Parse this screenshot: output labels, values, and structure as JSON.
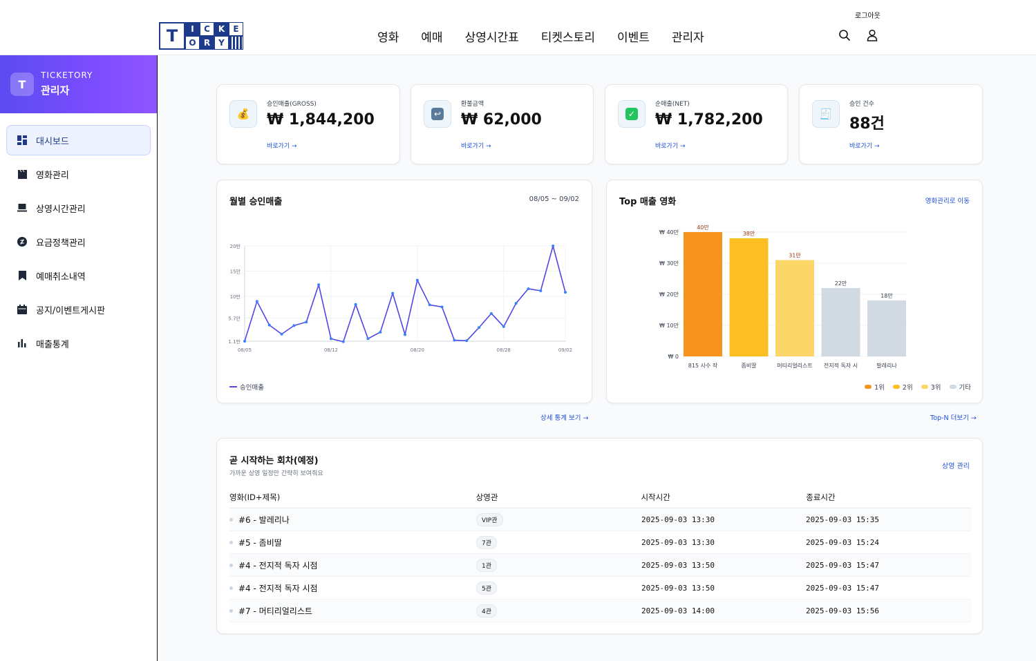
{
  "header": {
    "logout_label": "로그아웃",
    "logo": {
      "t": "T",
      "letters": [
        "I",
        "C",
        "K",
        "E",
        "O",
        "R",
        "Y",
        ""
      ]
    },
    "nav": [
      "영화",
      "예매",
      "상영시간표",
      "티켓스토리",
      "이벤트",
      "관리자"
    ],
    "icons": [
      "search-icon",
      "user-icon"
    ]
  },
  "sidebar": {
    "badge": "T",
    "brand": "TICKETORY",
    "title": "관리자",
    "items": [
      {
        "label": "대시보드",
        "icon": "dashboard-icon",
        "active": true
      },
      {
        "label": "영화관리",
        "icon": "clapper-icon"
      },
      {
        "label": "상영시간관리",
        "icon": "laptop-icon"
      },
      {
        "label": "요금정책관리",
        "icon": "currency-icon"
      },
      {
        "label": "예매취소내역",
        "icon": "bookmark-icon"
      },
      {
        "label": "공지/이벤트게시판",
        "icon": "calendar-icon"
      },
      {
        "label": "매출통계",
        "icon": "bar-chart-icon"
      }
    ]
  },
  "kpis": [
    {
      "label": "승인매출(GROSS)",
      "value": "₩ 1,844,200",
      "link": "바로가기 →",
      "icon": "money-bag-icon",
      "glyph": "💰"
    },
    {
      "label": "환불금액",
      "value": "₩ 62,000",
      "link": "바로가기 →",
      "icon": "return-icon",
      "glyph": "↩"
    },
    {
      "label": "순매출(NET)",
      "value": "₩ 1,782,200",
      "link": "바로가기 →",
      "icon": "check-icon",
      "glyph": "✓"
    },
    {
      "label": "승인 건수",
      "value": "88건",
      "link": "바로가기 →",
      "icon": "receipt-icon",
      "glyph": "🧾"
    }
  ],
  "line_card": {
    "title": "월별 승인매출",
    "range": "08/05 ~ 09/02",
    "legend": "승인매출",
    "under_link": "상세 통계 보기 →"
  },
  "bar_card": {
    "title": "Top 매출 영화",
    "link": "영화관리로 이동",
    "under_link": "Top-N 더보기 →",
    "legend": [
      {
        "label": "1위",
        "color": "#f7941d"
      },
      {
        "label": "2위",
        "color": "#fbbf24"
      },
      {
        "label": "3위",
        "color": "#fcd668"
      },
      {
        "label": "기타",
        "color": "#d1d9e3"
      }
    ]
  },
  "chart_data": [
    {
      "type": "line",
      "title": "월별 승인매출",
      "x_ticks": [
        "08/05",
        "08/12",
        "08/20",
        "08/28",
        "09/02"
      ],
      "y_ticks": [
        "1.1만",
        "5.7만",
        "10만",
        "15만",
        "20만"
      ],
      "ylim": [
        1.1,
        20
      ],
      "series": [
        {
          "name": "승인매출",
          "color": "#4f46e5",
          "values": [
            1.1,
            9.0,
            4.3,
            2.5,
            4.2,
            4.9,
            12.3,
            1.6,
            1.0,
            8.4,
            1.6,
            2.9,
            10.6,
            2.4,
            13.2,
            8.3,
            7.9,
            1.3,
            1.2,
            3.8,
            6.6,
            4.0,
            8.6,
            11.5,
            11.1,
            20.0,
            10.8
          ]
        }
      ]
    },
    {
      "type": "bar",
      "title": "Top 매출 영화",
      "categories": [
        "815 사수 작",
        "좀비딸",
        "머티리얼리스트",
        "전지적 독자 시",
        "발레리나"
      ],
      "values": [
        40,
        38,
        31,
        22,
        18
      ],
      "value_labels": [
        "40만",
        "38만",
        "31만",
        "22만",
        "18만"
      ],
      "colors": [
        "#f7941d",
        "#fbbf24",
        "#fcd668",
        "#d1d9e3",
        "#d1d9e3"
      ],
      "label_colors": [
        "#9a3412",
        "#9a3412",
        "#9a3412",
        "#374151",
        "#374151"
      ],
      "y_ticks": [
        "₩ 0",
        "₩ 10만",
        "₩ 20만",
        "₩ 30만",
        "₩ 40만"
      ],
      "ylim": [
        0,
        40
      ]
    }
  ],
  "upcoming": {
    "title": "곧 시작하는 회차(예정)",
    "subtitle": "가까운 상영 일정만 간략히 보여줘요",
    "link": "상영 관리",
    "columns": [
      "영화(ID+제목)",
      "상영관",
      "시작시간",
      "종료시간"
    ],
    "rows": [
      {
        "movie": "#6 - 발레리나",
        "hall": "VIP관",
        "start": "2025-09-03 13:30",
        "end": "2025-09-03 15:35"
      },
      {
        "movie": "#5 - 좀비딸",
        "hall": "7관",
        "start": "2025-09-03 13:30",
        "end": "2025-09-03 15:24"
      },
      {
        "movie": "#4 - 전지적 독자 시점",
        "hall": "1관",
        "start": "2025-09-03 13:50",
        "end": "2025-09-03 15:47"
      },
      {
        "movie": "#4 - 전지적 독자 시점",
        "hall": "5관",
        "start": "2025-09-03 13:50",
        "end": "2025-09-03 15:47"
      },
      {
        "movie": "#7 - 머티리얼리스트",
        "hall": "4관",
        "start": "2025-09-03 14:00",
        "end": "2025-09-03 15:56"
      }
    ]
  }
}
